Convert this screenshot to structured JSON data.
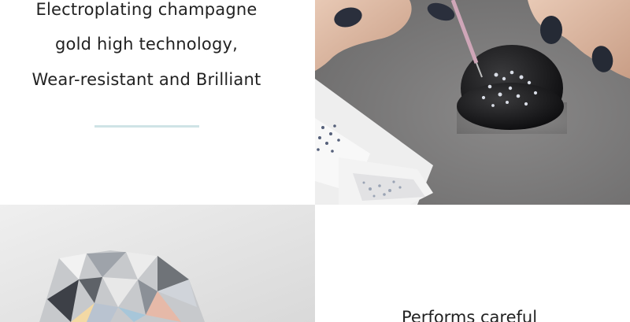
{
  "top_caption": {
    "line1": "Electroplating champagne",
    "line2": "gold high technology,",
    "line3": "Wear-resistant and Brilliant"
  },
  "bottom_caption": {
    "line1": "Performs careful"
  },
  "colors": {
    "divider": "#cfe3e6",
    "text": "#222222",
    "felt": "#7d7c7c"
  },
  "images": {
    "top_right": "hands-placing-rhinestones-photo",
    "bottom_left": "cut-diamond-photo"
  }
}
